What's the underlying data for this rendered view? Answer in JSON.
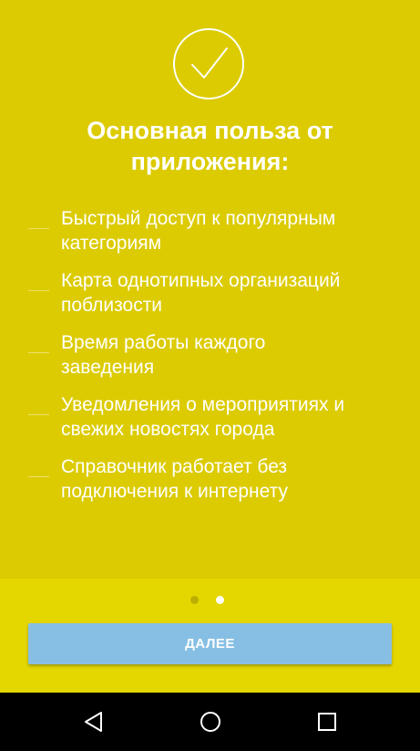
{
  "onboarding": {
    "title": "Основная польза от приложения:",
    "benefits": [
      {
        "text": "Быстрый доступ к популярным\nкатегориям"
      },
      {
        "text": "Карта однотипных организаций\nпоблизости"
      },
      {
        "text": "Время работы каждого\nзаведения"
      },
      {
        "text": "Уведомления о мероприятиях и\nсвежих новостях города"
      },
      {
        "text": "Справочник работает без\nподключения к интернету"
      }
    ],
    "pager": {
      "total": 2,
      "active": 2
    },
    "next_label": "ДАЛЕЕ"
  },
  "colors": {
    "background": "#dccb00",
    "footer": "#e4d700",
    "button": "#87bfe4",
    "text": "#ffffff"
  },
  "icons": {
    "header": "checkmark-circle-icon",
    "nav": [
      "back-icon",
      "home-icon",
      "recents-icon"
    ]
  }
}
